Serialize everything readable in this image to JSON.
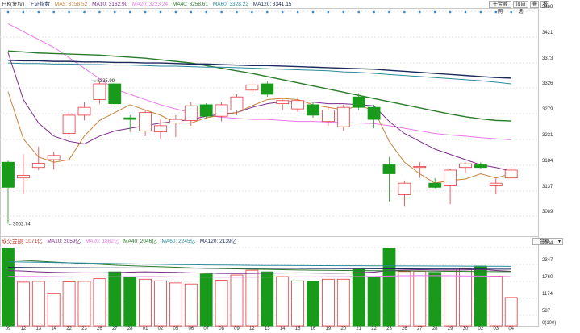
{
  "toolbar": {
    "buttons": [
      "十金融网",
      "加自选",
      "叠",
      "报"
    ]
  },
  "price_legend": {
    "period": "日K(复权)",
    "index": "上证指数",
    "ma5": "MA5: 3158.52",
    "ma10": "MA10: 3162.90",
    "ma20": "MA20: 3223.24",
    "ma40": "MA40: 3258.61",
    "ma60": "MA60: 3328.22",
    "ma120": "MA120: 3341.15"
  },
  "volume_legend": {
    "label": "成交金额: 1071亿",
    "ma10": "MA10: 2059亿",
    "ma20": "MA20: 1862亿",
    "ma40": "MA40: 2046亿",
    "ma60": "MA60: 2245亿",
    "ma120": "MA120: 2139亿"
  },
  "volume_select": "金额",
  "price_axis": [
    "3468",
    "3421",
    "3373",
    "3326",
    "3279",
    "3231",
    "3184",
    "3137",
    "3089"
  ],
  "volume_axis": [
    "2934",
    "2347",
    "1760",
    "1174",
    "587",
    "0(100)"
  ],
  "annotations": {
    "high": "3335.99",
    "low": "3062.74"
  },
  "colors": {
    "up": "#e8383d",
    "down": "#1a9a1a",
    "ma5": "#c8823a",
    "ma10": "#7b2a8a",
    "ma20": "#e878e8",
    "ma40": "#2a7a2a",
    "ma60": "#1a2a5a",
    "ma120": "#2a8a9a"
  },
  "chart_data": {
    "type": "candlestick",
    "x_dates": [
      "09",
      "12",
      "13",
      "14",
      "22",
      "23",
      "26",
      "27",
      "28",
      "01",
      "02",
      "05",
      "06",
      "07",
      "08",
      "09",
      "12",
      "13",
      "14",
      "15",
      "16",
      "19",
      "20",
      "21",
      "22",
      "23",
      "26",
      "27",
      "28",
      "29",
      "30",
      "02",
      "03",
      "04"
    ],
    "ohlc": [
      {
        "o": 3180,
        "h": 3183,
        "l": 3062,
        "c": 3132
      },
      {
        "o": 3150,
        "h": 3195,
        "l": 3120,
        "c": 3155
      },
      {
        "o": 3170,
        "h": 3210,
        "l": 3165,
        "c": 3178
      },
      {
        "o": 3185,
        "h": 3200,
        "l": 3166,
        "c": 3193
      },
      {
        "o": 3235,
        "h": 3275,
        "l": 3228,
        "c": 3270
      },
      {
        "o": 3270,
        "h": 3295,
        "l": 3260,
        "c": 3285
      },
      {
        "o": 3300,
        "h": 3336,
        "l": 3292,
        "c": 3330
      },
      {
        "o": 3330,
        "h": 3333,
        "l": 3285,
        "c": 3292
      },
      {
        "o": 3265,
        "h": 3270,
        "l": 3238,
        "c": 3262
      },
      {
        "o": 3240,
        "h": 3280,
        "l": 3230,
        "c": 3275
      },
      {
        "o": 3238,
        "h": 3262,
        "l": 3225,
        "c": 3250
      },
      {
        "o": 3255,
        "h": 3270,
        "l": 3228,
        "c": 3262
      },
      {
        "o": 3260,
        "h": 3295,
        "l": 3250,
        "c": 3288
      },
      {
        "o": 3290,
        "h": 3293,
        "l": 3262,
        "c": 3268
      },
      {
        "o": 3268,
        "h": 3295,
        "l": 3258,
        "c": 3290
      },
      {
        "o": 3280,
        "h": 3310,
        "l": 3270,
        "c": 3305
      },
      {
        "o": 3318,
        "h": 3335,
        "l": 3310,
        "c": 3328
      },
      {
        "o": 3330,
        "h": 3335,
        "l": 3305,
        "c": 3310
      },
      {
        "o": 3292,
        "h": 3300,
        "l": 3280,
        "c": 3298
      },
      {
        "o": 3282,
        "h": 3305,
        "l": 3276,
        "c": 3298
      },
      {
        "o": 3290,
        "h": 3295,
        "l": 3265,
        "c": 3270
      },
      {
        "o": 3258,
        "h": 3285,
        "l": 3250,
        "c": 3280
      },
      {
        "o": 3248,
        "h": 3290,
        "l": 3240,
        "c": 3285
      },
      {
        "o": 3305,
        "h": 3312,
        "l": 3280,
        "c": 3285
      },
      {
        "o": 3285,
        "h": 3290,
        "l": 3245,
        "c": 3262
      },
      {
        "o": 3175,
        "h": 3190,
        "l": 3105,
        "c": 3158
      },
      {
        "o": 3118,
        "h": 3145,
        "l": 3095,
        "c": 3140
      },
      {
        "o": 3170,
        "h": 3180,
        "l": 3150,
        "c": 3172
      },
      {
        "o": 3140,
        "h": 3150,
        "l": 3130,
        "c": 3132
      },
      {
        "o": 3135,
        "h": 3168,
        "l": 3100,
        "c": 3165
      },
      {
        "o": 3170,
        "h": 3180,
        "l": 3160,
        "c": 3177
      },
      {
        "o": 3175,
        "h": 3180,
        "l": 3168,
        "c": 3170
      },
      {
        "o": 3135,
        "h": 3150,
        "l": 3120,
        "c": 3140
      },
      {
        "o": 3150,
        "h": 3170,
        "l": 3150,
        "c": 3165
      }
    ],
    "volume": [
      2934,
      1650,
      1680,
      1210,
      1660,
      1680,
      1780,
      2040,
      1820,
      1760,
      1700,
      1620,
      1580,
      1960,
      1720,
      1920,
      2100,
      2040,
      1860,
      1700,
      1680,
      1760,
      1760,
      2130,
      1840,
      2934,
      2050,
      2060,
      2020,
      2110,
      2160,
      2260,
      1880,
      1071
    ],
    "ma5": [
      3315,
      3225,
      3190,
      3180,
      3185,
      3230,
      3260,
      3275,
      3290,
      3280,
      3270,
      3255,
      3255,
      3265,
      3270,
      3275,
      3288,
      3300,
      3302,
      3300,
      3290,
      3285,
      3280,
      3288,
      3280,
      3220,
      3180,
      3158,
      3140,
      3145,
      3148,
      3158,
      3150,
      3158
    ],
    "ma10": [
      3390,
      3300,
      3255,
      3230,
      3220,
      3215,
      3230,
      3240,
      3245,
      3250,
      3255,
      3258,
      3262,
      3268,
      3272,
      3275,
      3285,
      3292,
      3296,
      3296,
      3295,
      3292,
      3292,
      3290,
      3288,
      3258,
      3235,
      3220,
      3205,
      3195,
      3185,
      3175,
      3170,
      3163
    ],
    "ma20": [
      3445,
      3430,
      3415,
      3400,
      3380,
      3360,
      3340,
      3320,
      3310,
      3300,
      3290,
      3282,
      3275,
      3270,
      3266,
      3264,
      3262,
      3262,
      3260,
      3258,
      3258,
      3257,
      3256,
      3255,
      3254,
      3250,
      3245,
      3240,
      3235,
      3232,
      3230,
      3227,
      3225,
      3223
    ],
    "ma40": [
      3393,
      3391,
      3389,
      3388,
      3387,
      3386,
      3385,
      3383,
      3381,
      3379,
      3376,
      3373,
      3370,
      3365,
      3360,
      3355,
      3350,
      3344,
      3338,
      3332,
      3326,
      3320,
      3314,
      3308,
      3302,
      3296,
      3290,
      3284,
      3278,
      3272,
      3267,
      3263,
      3260,
      3259
    ],
    "ma60": [
      3375,
      3374,
      3374,
      3373,
      3373,
      3372,
      3372,
      3371,
      3371,
      3370,
      3370,
      3369,
      3368,
      3368,
      3367,
      3366,
      3365,
      3365,
      3364,
      3363,
      3362,
      3361,
      3360,
      3359,
      3358,
      3356,
      3354,
      3352,
      3350,
      3348,
      3346,
      3344,
      3342,
      3341
    ],
    "ma120": [
      3370,
      3369,
      3369,
      3368,
      3368,
      3367,
      3367,
      3366,
      3366,
      3365,
      3364,
      3364,
      3363,
      3362,
      3362,
      3361,
      3360,
      3359,
      3358,
      3357,
      3356,
      3355,
      3353,
      3352,
      3350,
      3348,
      3346,
      3344,
      3342,
      3340,
      3338,
      3336,
      3333,
      3330
    ],
    "vol_ma": {
      "ma10": [
        2090,
        2070,
        2040,
        2020,
        2010,
        2000,
        2000,
        2010,
        2030,
        2040,
        2030,
        2020,
        2000,
        1990,
        1980,
        1975,
        1980,
        1990,
        1995,
        2000,
        1995,
        1985,
        1990,
        2010,
        2030,
        2090,
        2110,
        2120,
        2110,
        2105,
        2110,
        2130,
        2090,
        2059
      ],
      "ma20": [
        1870,
        1865,
        1860,
        1855,
        1850,
        1845,
        1848,
        1852,
        1856,
        1860,
        1855,
        1850,
        1845,
        1840,
        1838,
        1836,
        1838,
        1840,
        1845,
        1848,
        1850,
        1852,
        1855,
        1860,
        1865,
        1880,
        1890,
        1895,
        1895,
        1890,
        1885,
        1880,
        1870,
        1862
      ],
      "ma40": [
        2500,
        2470,
        2440,
        2410,
        2380,
        2350,
        2320,
        2290,
        2270,
        2250,
        2230,
        2210,
        2190,
        2170,
        2160,
        2150,
        2140,
        2130,
        2120,
        2110,
        2100,
        2095,
        2090,
        2085,
        2080,
        2078,
        2075,
        2070,
        2065,
        2060,
        2055,
        2052,
        2049,
        2046
      ],
      "ma60": [
        2420,
        2410,
        2400,
        2390,
        2380,
        2370,
        2360,
        2350,
        2340,
        2330,
        2320,
        2310,
        2305,
        2300,
        2295,
        2290,
        2285,
        2280,
        2278,
        2276,
        2274,
        2272,
        2270,
        2268,
        2266,
        2264,
        2262,
        2260,
        2258,
        2256,
        2254,
        2250,
        2248,
        2245
      ],
      "ma120": [
        2210,
        2205,
        2200,
        2197,
        2195,
        2192,
        2190,
        2188,
        2186,
        2184,
        2182,
        2180,
        2178,
        2176,
        2174,
        2172,
        2170,
        2168,
        2166,
        2164,
        2162,
        2160,
        2158,
        2156,
        2154,
        2152,
        2150,
        2148,
        2146,
        2145,
        2143,
        2142,
        2140,
        2139
      ]
    },
    "price_range": [
      3040,
      3475
    ],
    "volume_range": [
      0,
      3050
    ]
  }
}
